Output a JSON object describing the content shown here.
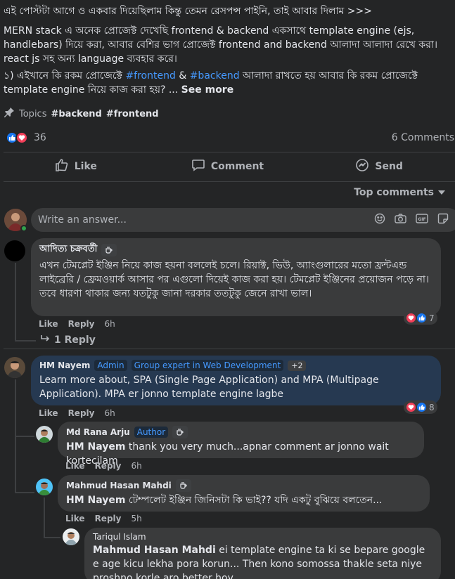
{
  "post": {
    "line1": "এই পোস্টটা আগে ও একবার দিয়েছিলাম কিন্তু তেমন রেসপন্স পাইনি, তাই আবার দিলাম >>>",
    "para2": "MERN stack এ অনেক প্রোজেক্ট দেখেছি frontend & backend একসাথে template engine (ejs, handlebars) দিয়ে করা, আবার বেশির ভাগ প্রোজেক্ট  frontend and backend আলাদা আলাদা রেখে করা। react js সহ অন্য language ব্যবহার করে।",
    "para3_a": "১) এইখানে কি রকম প্রোজেক্টে ",
    "para3_tag1": "#frontend",
    "para3_b": " & ",
    "para3_tag2": "#backend",
    "para3_c": "  আলাদা রাখতে হয় আবার কি রকম প্রোজেক্টে template engine নিয়ে কাজ করা হয়? ... ",
    "see_more": "See more"
  },
  "topics": {
    "label": "Topics",
    "tag1": "#backend",
    "tag2": "#frontend"
  },
  "reactions": {
    "count": "36",
    "comments": "6 Comments"
  },
  "actions": {
    "like": "Like",
    "comment": "Comment",
    "send": "Send"
  },
  "sort": {
    "label": "Top comments"
  },
  "composer": {
    "placeholder": "Write an answer..."
  },
  "comments": [
    {
      "author": "আদিত্য চক্রবর্তী",
      "text": "এখন টেমপ্লেট ইঞ্জিন নিয়ে কাজ হয়না বললেই চলে। রিয়াক্ট, ভিউ, অ্যাংগুলারের মতো ফ্রন্টএন্ড লাইব্রেরি / ফ্রেমওয়ার্ক আসার পর এগুলো দিয়েই কাজ করা হয়। টেমপ্লেট ইঞ্জিনের প্রয়োজন পড়ে না। তবে ধারণা থাকার জন্য যতটুকু জানা দরকার ততটুকু জেনে রাখা ভাল।",
      "like": "Like",
      "reply": "Reply",
      "time": "6h",
      "react_count": "7",
      "replies_link": "1 Reply"
    },
    {
      "author": "HM Nayem",
      "badge1": "Admin",
      "badge2": "Group expert in Web Development",
      "badge3": "+2",
      "text": "Learn more about, SPA (Single Page Application) and MPA (Multipage Application). MPA er jonno template engine lagbe",
      "like": "Like",
      "reply": "Reply",
      "time": "6h",
      "react_count": "8"
    }
  ],
  "replies": [
    {
      "author": "Md Rana Arju",
      "badge": "Author",
      "mention": "HM Nayem",
      "text": " thank you very much...apnar comment ar jonno wait kortecilam",
      "like": "Like",
      "reply": "Reply",
      "time": "6h"
    },
    {
      "author": "Mahmud Hasan Mahdi",
      "mention": "HM Nayem",
      "text": " টেম্পলেট ইঞ্জিন জিনিসটা কি ভাই?? যদি একটু বুঝিয়ে বলতেন...",
      "like": "Like",
      "reply": "Reply",
      "time": "5h"
    },
    {
      "author": "Tariqul Islam",
      "mention": "Mahmud Hasan Mahdi",
      "text": " ei template engine ta ki se bepare google e age kicu lekha pora korun... Then kono somossa thakle seta niye proshno korle aro better hoy"
    }
  ],
  "colors": {
    "background": "#242526",
    "bubble": "#3a3b3c",
    "bubble_highlight": "#263951",
    "link": "#4599ff",
    "like_blue": "#1877f2",
    "love_red": "#f33e58"
  }
}
